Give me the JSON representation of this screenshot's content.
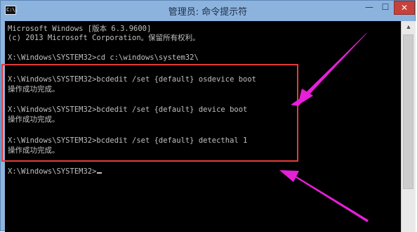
{
  "window": {
    "title": "管理员: 命令提示符",
    "app_icon_text": "C:\\.",
    "controls": {
      "minimize": "—",
      "maximize": "☐",
      "close": "✕"
    }
  },
  "console": {
    "lines": [
      "Microsoft Windows [版本 6.3.9600]",
      "(c) 2013 Microsoft Corporation。保留所有权利。",
      "X:\\Windows\\SYSTEM32>cd c:\\windows\\system32\\",
      "X:\\Windows\\SYSTEM32>bcdedit /set {default} osdevice boot",
      "操作成功完成。",
      "X:\\Windows\\SYSTEM32>bcdedit /set {default} device boot",
      "操作成功完成。",
      "X:\\Windows\\SYSTEM32>bcdedit /set {default} detecthal 1",
      "操作成功完成。",
      "X:\\Windows\\SYSTEM32>"
    ]
  },
  "annotation": {
    "highlight_color": "#e63b3b",
    "arrow_color": "#e61fd8"
  }
}
